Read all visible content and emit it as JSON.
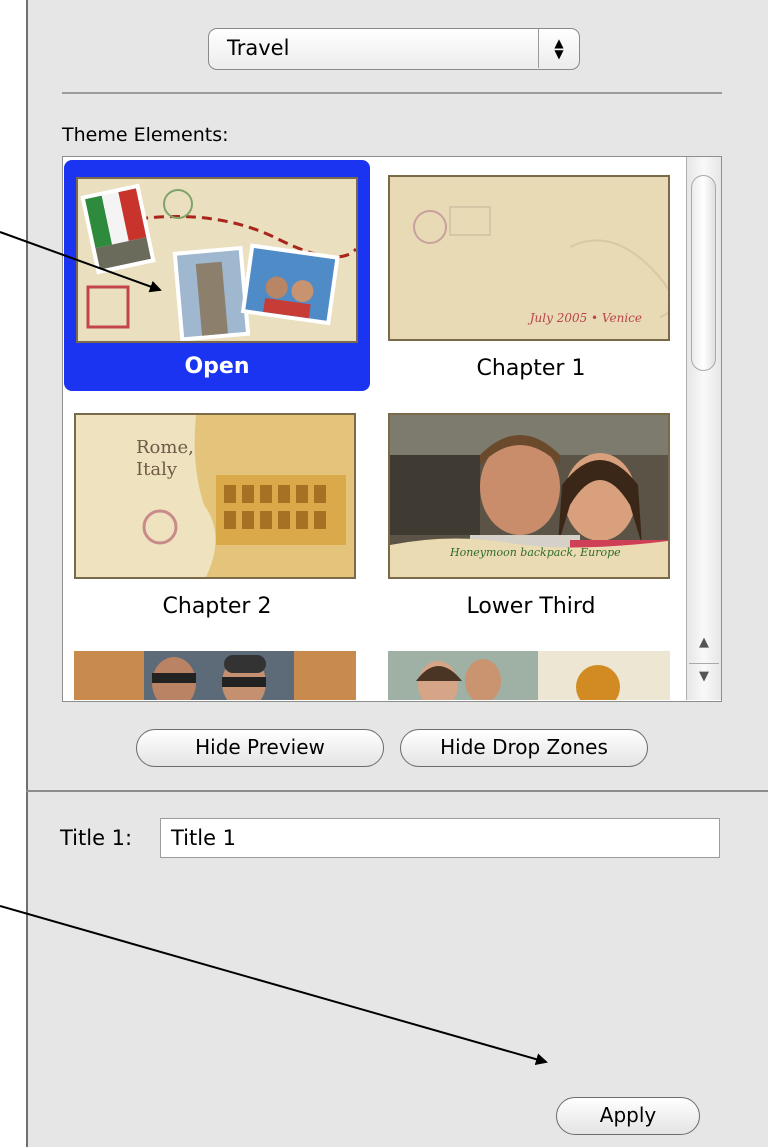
{
  "theme_select": {
    "value": "Travel",
    "stepper_up": "▲",
    "stepper_down": "▼"
  },
  "theme_elements": {
    "label": "Theme Elements:",
    "items": [
      {
        "label": "Open",
        "selected": true
      },
      {
        "label": "Chapter 1",
        "selected": false,
        "caption": "July 2005 • Venice"
      },
      {
        "label": "Chapter 2",
        "selected": false,
        "caption": "Rome, Italy"
      },
      {
        "label": "Lower Third",
        "selected": false,
        "caption": "Honeymoon backpack, Europe"
      }
    ]
  },
  "scrollbar": {
    "up": "▲",
    "down": "▼"
  },
  "buttons": {
    "hide_preview": "Hide Preview",
    "hide_drop_zones": "Hide Drop Zones",
    "apply": "Apply"
  },
  "title_field": {
    "label": "Title 1:",
    "value": "Title 1"
  },
  "colors": {
    "selection": "#1a34f2",
    "panel": "#e6e6e6",
    "parchment": "#e9dcb8"
  }
}
